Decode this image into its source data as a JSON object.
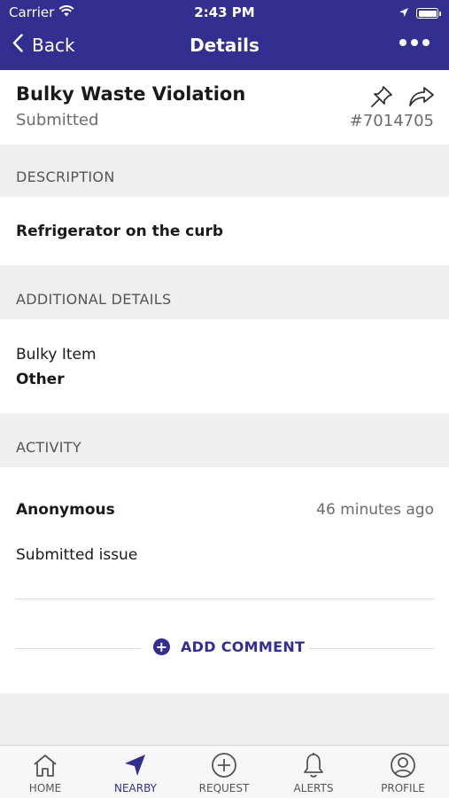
{
  "status_bar": {
    "carrier": "Carrier",
    "time": "2:43 PM",
    "icons": [
      "wifi-icon",
      "location-arrow-icon",
      "battery-icon"
    ]
  },
  "nav": {
    "back_label": "Back",
    "title": "Details",
    "more_icon": "more-icon"
  },
  "issue": {
    "title": "Bulky Waste Violation",
    "status": "Submitted",
    "id": "#7014705",
    "actions": [
      "pin-icon",
      "share-icon"
    ]
  },
  "description": {
    "header": "DESCRIPTION",
    "text": "Refrigerator on the curb"
  },
  "additional_details": {
    "header": "ADDITIONAL DETAILS",
    "label": "Bulky Item",
    "value": "Other"
  },
  "activity": {
    "header": "ACTIVITY",
    "author": "Anonymous",
    "time": "46 minutes ago",
    "text": "Submitted issue",
    "add_comment": "ADD COMMENT"
  },
  "tabs": [
    {
      "label": "HOME",
      "icon": "home-icon",
      "active": false
    },
    {
      "label": "NEARBY",
      "icon": "navigation-arrow-icon",
      "active": true
    },
    {
      "label": "REQUEST",
      "icon": "plus-circle-icon",
      "active": false
    },
    {
      "label": "ALERTS",
      "icon": "bell-icon",
      "active": false
    },
    {
      "label": "PROFILE",
      "icon": "user-icon",
      "active": false
    }
  ],
  "colors": {
    "brand": "#332f91",
    "background": "#efefef",
    "muted_text": "#6b6b6b"
  }
}
